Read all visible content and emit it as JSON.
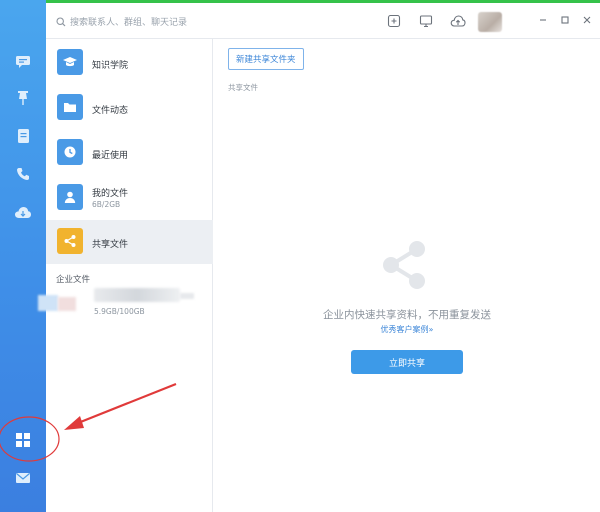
{
  "search": {
    "placeholder": "搜索联系人、群组、聊天记录"
  },
  "sidebar": {
    "items": [
      {
        "icon": "chat-icon"
      },
      {
        "icon": "pin-icon"
      },
      {
        "icon": "document-icon"
      },
      {
        "icon": "phone-icon"
      },
      {
        "icon": "cloud-icon"
      },
      {
        "icon": "apps-grid-icon"
      },
      {
        "icon": "mail-icon"
      }
    ]
  },
  "list": {
    "items": [
      {
        "label": "知识学院",
        "icon": "graduation-cap-icon",
        "color": "#4a9ae6"
      },
      {
        "label": "文件动态",
        "icon": "folder-icon",
        "color": "#4a9ae6"
      },
      {
        "label": "最近使用",
        "icon": "clock-icon",
        "color": "#4a9ae6"
      },
      {
        "label": "我的文件",
        "sub": "6B/2GB",
        "icon": "user-icon",
        "color": "#4a9ae6"
      },
      {
        "label": "共享文件",
        "icon": "share-icon",
        "color": "#f1b32e"
      }
    ],
    "enterprise_section": "企业文件",
    "enterprise_size": "5.9GB/100GB"
  },
  "main": {
    "new_folder_label": "新建共享文件夹",
    "breadcrumb": "共享文件",
    "empty_title": "企业内快速共享资料，不用重复发送",
    "empty_link": "优秀客户案例»",
    "share_button": "立即共享"
  },
  "colors": {
    "rail": "#3f8fe8",
    "accent": "#3d9ae8",
    "share_icon": "#f1b32e",
    "annotation": "#e03a3a"
  }
}
